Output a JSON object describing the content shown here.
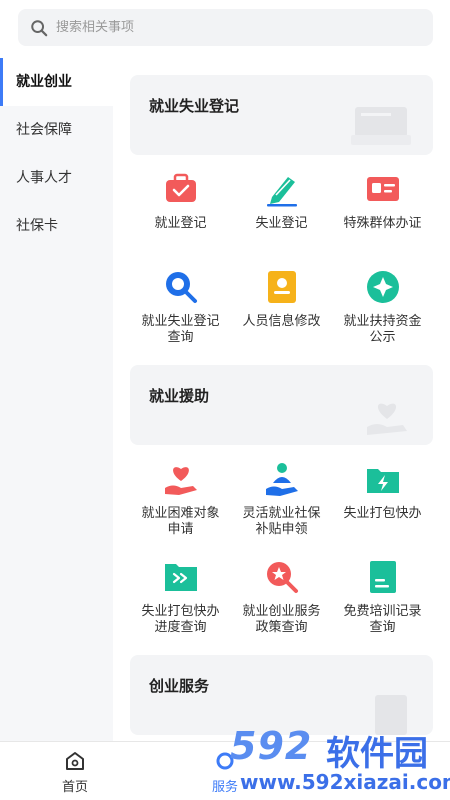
{
  "search": {
    "placeholder": "搜索相关事项"
  },
  "sidebar": {
    "items": [
      {
        "label": "就业创业",
        "active": true
      },
      {
        "label": "社会保障"
      },
      {
        "label": "人事人才"
      },
      {
        "label": "社保卡"
      }
    ]
  },
  "sections": [
    {
      "title": "就业失业登记",
      "items": [
        {
          "label": "就业登记",
          "icon": "briefcase-icon"
        },
        {
          "label": "失业登记",
          "icon": "pen-icon"
        },
        {
          "label": "特殊群体办证",
          "icon": "id-card-icon"
        },
        {
          "label": "就业失业登记查询",
          "icon": "magnifier-icon"
        },
        {
          "label": "人员信息修改",
          "icon": "person-card-icon"
        },
        {
          "label": "就业扶持资金公示",
          "icon": "star-badge-icon"
        }
      ]
    },
    {
      "title": "就业援助",
      "items": [
        {
          "label": "就业困难对象申请",
          "icon": "heart-hand-icon"
        },
        {
          "label": "灵活就业社保补贴申领",
          "icon": "person-hand-icon"
        },
        {
          "label": "失业打包快办",
          "icon": "folder-bolt-icon"
        },
        {
          "label": "失业打包快办进度查询",
          "icon": "folder-arrow-icon"
        },
        {
          "label": "就业创业服务政策查询",
          "icon": "star-search-icon"
        },
        {
          "label": "免费培训记录查询",
          "icon": "document-icon"
        }
      ]
    },
    {
      "title": "创业服务"
    }
  ],
  "tabbar": {
    "home": "首页",
    "service": "服务"
  },
  "watermark": {
    "num": "592",
    "cn": "软件园",
    "url": "www.592xiazai.com"
  },
  "colors": {
    "accent": "#3d7bf7",
    "red": "#f25a5a",
    "teal": "#1bbf9a",
    "blue": "#1f6fe8",
    "yellow": "#f6b21a"
  }
}
